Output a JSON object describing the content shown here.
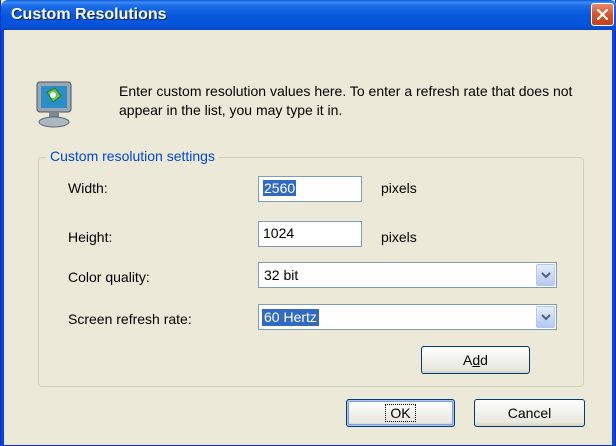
{
  "window": {
    "title": "Custom Resolutions"
  },
  "intro": {
    "text": "Enter custom resolution values here. To enter a refresh rate that does not appear in the list, you may type it in."
  },
  "group": {
    "label": "Custom resolution settings"
  },
  "width": {
    "label": "Width:",
    "value": "2560",
    "unit": "pixels"
  },
  "height": {
    "label": "Height:",
    "value": "1024",
    "unit": "pixels"
  },
  "color_quality": {
    "label": "Color quality:",
    "value": "32 bit"
  },
  "refresh_rate": {
    "label": "Screen refresh rate:",
    "value": "60 Hertz"
  },
  "buttons": {
    "add_pre": "A",
    "add_accel": "d",
    "add_post": "d",
    "ok": "OK",
    "cancel": "Cancel"
  },
  "colors": {
    "title_bar": "#0658de",
    "group_label": "#0046d5",
    "selection": "#316ac5",
    "close": "#d8532c"
  },
  "icons": {
    "close": "close-icon",
    "monitor": "monitor-icon",
    "dropdown": "chevron-down-icon"
  }
}
